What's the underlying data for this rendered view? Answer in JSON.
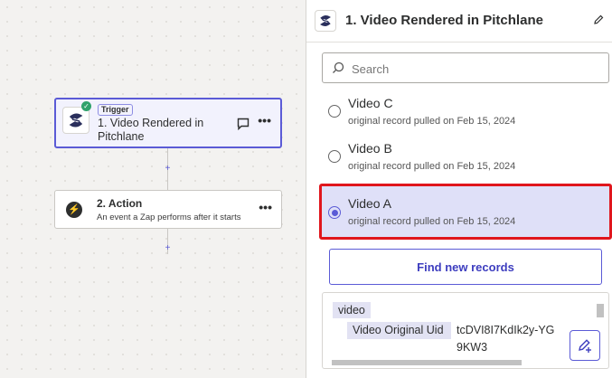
{
  "canvas": {
    "trigger_step": {
      "badge": "Trigger",
      "title": "1. Video Rendered in Pitchlane"
    },
    "action_step": {
      "title": "2. Action",
      "description": "An event a Zap performs after it starts"
    },
    "add_symbol": "+",
    "more_symbol": "•••",
    "check_symbol": "✓",
    "bolt_symbol": "⚡"
  },
  "panel": {
    "title": "1. Video Rendered in Pitchlane",
    "search_placeholder": "Search",
    "records": [
      {
        "name": "Video C",
        "subtitle": "original record pulled on Feb 15, 2024",
        "selected": false
      },
      {
        "name": "Video B",
        "subtitle": "original record pulled on Feb 15, 2024",
        "selected": false
      },
      {
        "name": "Video A",
        "subtitle": "original record pulled on Feb 15, 2024",
        "selected": true
      }
    ],
    "find_button": "Find new records",
    "data_preview": {
      "group": "video",
      "key": "Video Original Uid",
      "value": "tcDVI8I7KdIk2y-YG9KW3"
    }
  },
  "colors": {
    "accent": "#5b5bd6",
    "highlight": "#e0161d",
    "selected_bg": "#dfe0f8",
    "success": "#2fa26b"
  }
}
